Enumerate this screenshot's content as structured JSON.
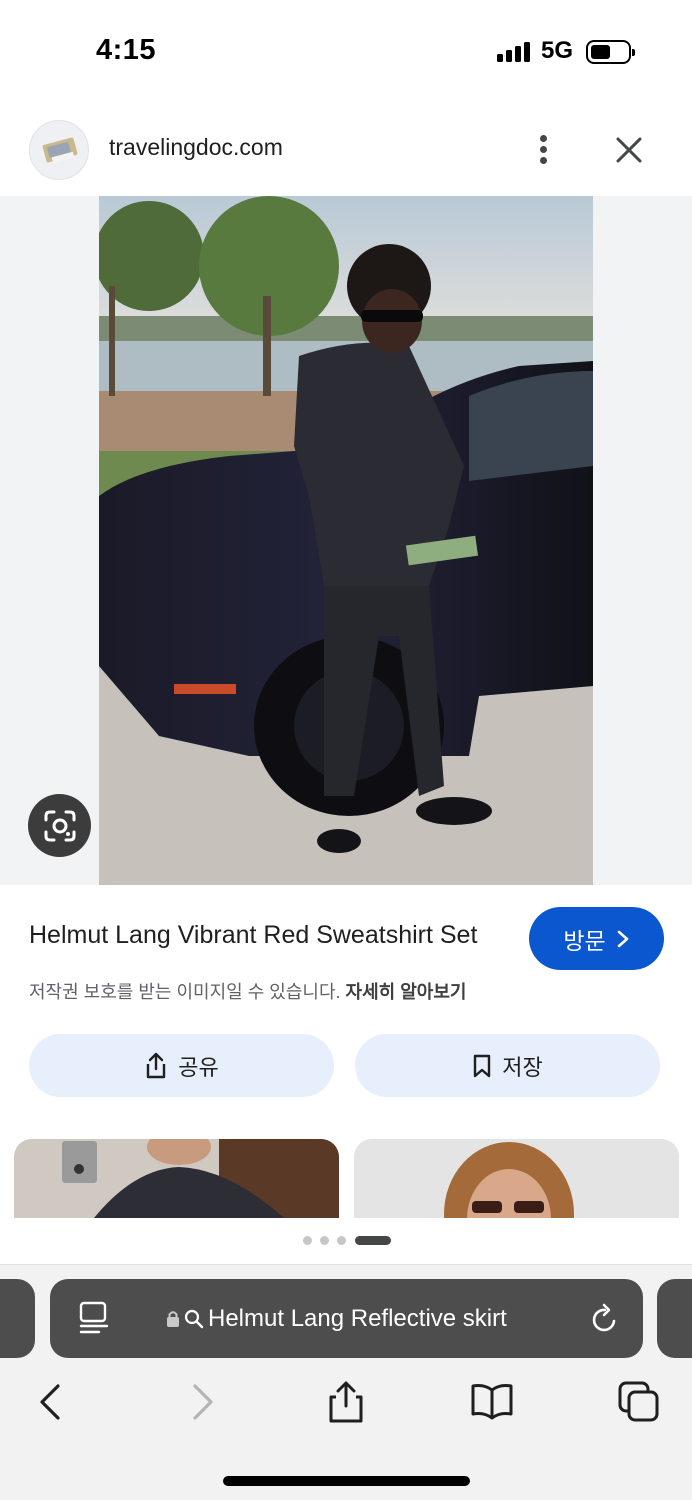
{
  "status_bar": {
    "time": "4:15",
    "network": "5G"
  },
  "site_header": {
    "domain": "travelingdoc.com",
    "more_icon": "more-vert-icon",
    "close_icon": "close-icon"
  },
  "image": {
    "description_icon": "lens-icon"
  },
  "details": {
    "title": "Helmut Lang Vibrant Red Sweatshirt Set",
    "visit_label": "방문",
    "copyright_text": "저작권 보호를 받는 이미지일 수 있습니다.",
    "learn_more": "자세히 알아보기",
    "share_label": "공유",
    "save_label": "저장"
  },
  "colors": {
    "accent": "#0b57d0",
    "action_bg": "#e7eefc",
    "url_bar_bg": "#4d4d4d"
  },
  "pagination": {
    "count": 4,
    "active_index": 3
  },
  "browser": {
    "url_text": "Helmut Lang Reflective skirt",
    "toolbar": [
      "back-icon",
      "forward-icon",
      "share-icon",
      "bookmarks-icon",
      "tabs-icon"
    ]
  }
}
